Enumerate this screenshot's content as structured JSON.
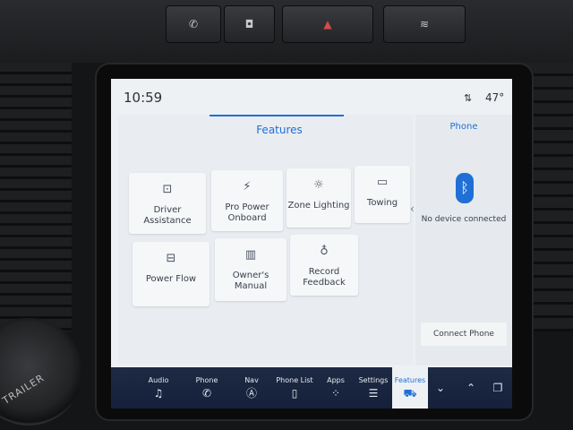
{
  "status": {
    "time": "10:59",
    "temperature": "47°",
    "signal_icon": "signal-arrows-icon"
  },
  "features": {
    "title": "Features",
    "tiles": [
      {
        "label": "Driver Assistance",
        "icon": "driver-assist-icon"
      },
      {
        "label": "Pro Power Onboard",
        "icon": "plug-icon"
      },
      {
        "label": "Zone Lighting",
        "icon": "light-icon"
      },
      {
        "label": "Towing",
        "icon": "trailer-icon"
      },
      {
        "label": "Power Flow",
        "icon": "battery-flow-icon"
      },
      {
        "label": "Owner's Manual",
        "icon": "book-icon"
      },
      {
        "label": "Record Feedback",
        "icon": "microphone-icon"
      }
    ]
  },
  "phone": {
    "title": "Phone",
    "status": "No device connected",
    "connect_label": "Connect Phone"
  },
  "nav": {
    "items": [
      {
        "label": "Audio",
        "icon": "♫"
      },
      {
        "label": "Phone",
        "icon": "✆"
      },
      {
        "label": "Nav",
        "icon": "Ⓐ"
      },
      {
        "label": "Phone List",
        "icon": "▯"
      },
      {
        "label": "Apps",
        "icon": "⁘"
      },
      {
        "label": "Settings",
        "icon": "☰"
      },
      {
        "label": "Features",
        "icon": "⛟"
      }
    ],
    "active": "Features"
  },
  "colors": {
    "accent": "#1f6fd6",
    "nav_bg": "#1e2a44",
    "screen_bg": "#eef1f4"
  },
  "dashboard": {
    "knob_label": "TRAILER"
  }
}
